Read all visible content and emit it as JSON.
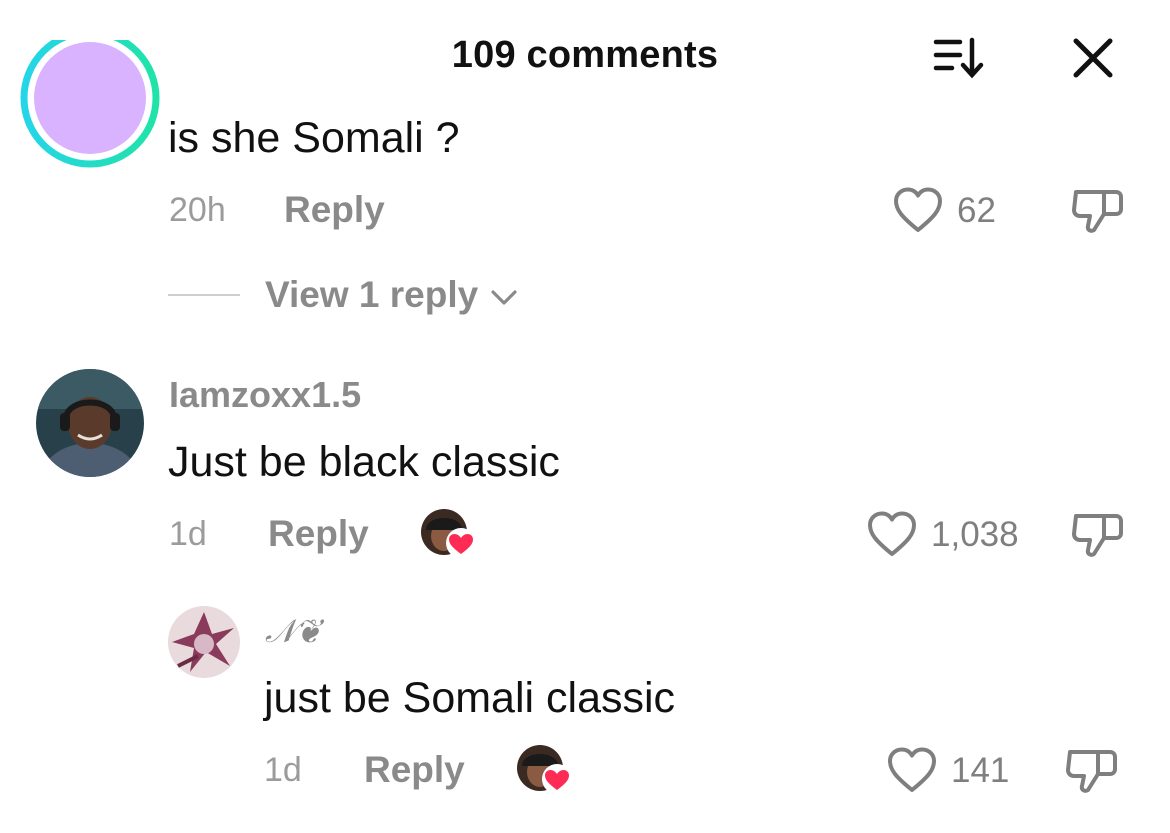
{
  "header": {
    "title": "109 comments"
  },
  "comments": [
    {
      "text": "is she Somali ?",
      "time": "20h",
      "reply": "Reply",
      "likes": "62",
      "view_replies": "View 1 reply"
    },
    {
      "username": "Iamzoxx1.5",
      "text": "Just be black classic",
      "time": "1d",
      "reply": "Reply",
      "likes": "1,038"
    },
    {
      "username": "𝒩❦",
      "text": "just be Somali classic",
      "time": "1d",
      "reply": "Reply",
      "likes": "141"
    }
  ],
  "colors": {
    "heart_accent": "#fe2c55",
    "ring_gradient_start": "#25d5e8",
    "ring_gradient_end": "#20e3a8"
  },
  "icons": [
    "sort-icon",
    "close-icon",
    "heart-icon",
    "dislike-icon",
    "chevron-down-icon"
  ]
}
